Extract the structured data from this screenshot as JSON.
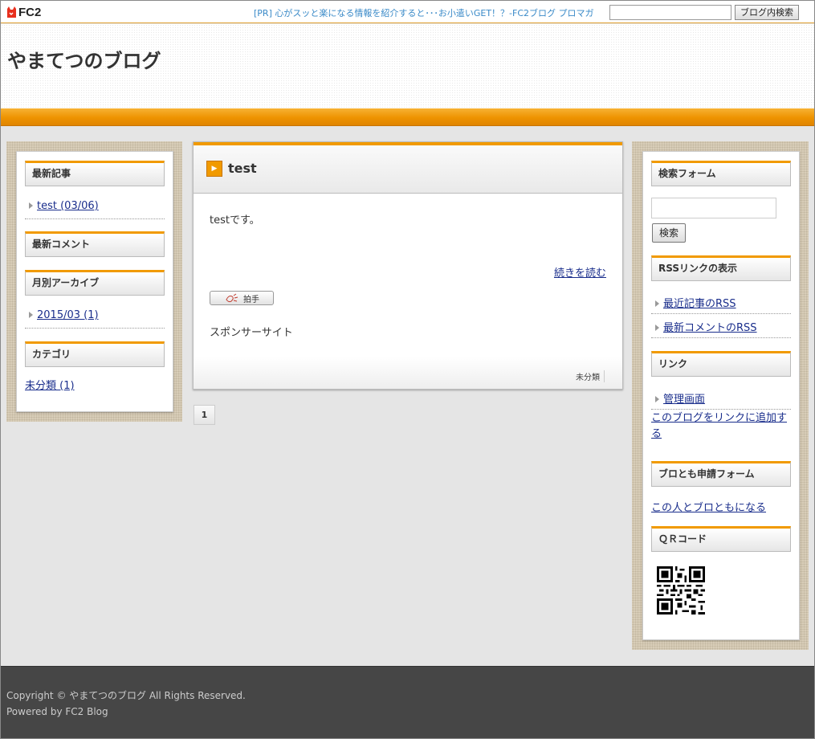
{
  "topbar": {
    "logo_text": "FC2",
    "pr_text": "[PR] 心がスッと楽になる情報を紹介すると･･･お小遣いGET！？-FC2ブログ プロマガ",
    "search_button": "ブログ内検索",
    "search_value": ""
  },
  "header": {
    "blog_title": "やまてつのブログ"
  },
  "left_sidebar": {
    "recent_entries_title": "最新記事",
    "recent_entries": [
      "test (03/06)"
    ],
    "recent_comments_title": "最新コメント",
    "archives_title": "月別アーカイブ",
    "archives": [
      "2015/03 (1)"
    ],
    "category_title": "カテゴリ",
    "categories": [
      "未分類 (1)"
    ]
  },
  "entry": {
    "title": "test",
    "body": "testです。",
    "read_more": "続きを読む",
    "clap_label": "拍手",
    "sponsor": "スポンサーサイト",
    "category": "未分類"
  },
  "pager": {
    "current": "1"
  },
  "right_sidebar": {
    "search_title": "検索フォーム",
    "search_button": "検索",
    "search_value": "",
    "rss_title": "RSSリンクの表示",
    "rss_links": [
      "最近記事のRSS",
      "最新コメントのRSS"
    ],
    "links_title": "リンク",
    "links": [
      "管理画面"
    ],
    "add_link": "このブログをリンクに追加する",
    "friend_title": "ブロとも申請フォーム",
    "friend_link": "この人とブロともになる",
    "qr_title": "ＱＲコード"
  },
  "footer": {
    "copyright": "Copyright © やまてつのブログ All Rights Reserved.",
    "powered": "Powered by FC2 Blog"
  },
  "colors": {
    "accent": "#f19a00",
    "link": "#1a2e8c",
    "footer_bg": "#464646"
  }
}
